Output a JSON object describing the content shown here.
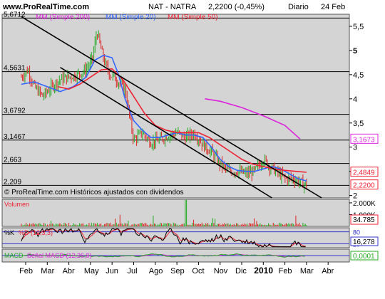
{
  "header": {
    "site": "www.ProRealTime.com",
    "instrument": "NAT - NATRA",
    "last": "2,2200 (-0,45%)",
    "period": "Diario",
    "date": "24 Feb"
  },
  "legend": {
    "ma200": "MM (Simple 200)",
    "ma20": "MM (Simple 20)",
    "ma50": "MM (Simple 50)"
  },
  "notice": "© ProRealTime.com Históricos ajustados con dividendos",
  "colors": {
    "background": "#d4d4d4",
    "price_up": "#22aa22",
    "price_down": "#dd2222",
    "ma20": "#3366ff",
    "ma50": "#ee2233",
    "ma200": "#dd22dd",
    "trendline": "#000000"
  },
  "price_panel": {
    "y_ticks": [
      "5,5",
      "5",
      "4,5",
      "4",
      "3,5",
      "3",
      "2,5",
      "2"
    ],
    "y_tick_values": [
      5.5,
      5,
      4.5,
      4,
      3.5,
      3,
      2.5,
      2
    ],
    "ylim": [
      1.95,
      5.75
    ],
    "level_labels": [
      "5,6712",
      "4,5631",
      "3,6792",
      "3,1467",
      "2,663",
      "2,209"
    ],
    "level_values": [
      5.6712,
      4.5631,
      3.6792,
      3.1467,
      2.663,
      2.209
    ],
    "badges": [
      {
        "text": "3,1673",
        "value": 3.1673,
        "color": "#dd22dd"
      },
      {
        "text": "2,4849",
        "value": 2.4849,
        "color": "#ee2233"
      },
      {
        "text": "2,2200",
        "value": 2.22,
        "color": "#ee2233"
      }
    ]
  },
  "volume_panel": {
    "label": "Volumen",
    "ticks": [
      "2.000K",
      "1.000K"
    ],
    "tick_values": [
      2000,
      1000
    ],
    "max": 2300,
    "last_badge": "34.785"
  },
  "k_panel": {
    "label": "%K",
    "sub": "%D (12,3,3)",
    "ticks": [
      "80",
      "20"
    ],
    "tick_values": [
      80,
      20
    ],
    "last_badge": "16,278"
  },
  "macd_panel": {
    "label": "MACD",
    "sub": "Señal MACD (12,26,9)",
    "last_badge": "0,0001"
  },
  "x_axis": {
    "labels": [
      "Feb",
      "Mar",
      "Abr",
      "May",
      "Jun",
      "Jul",
      "Ago",
      "Sep",
      "Oct",
      "Nov",
      "Dic",
      "2010",
      "Feb",
      "Mar",
      "Abr"
    ],
    "month_index": [
      0,
      1,
      2,
      3,
      4,
      5,
      6,
      7,
      8,
      9,
      10,
      11,
      12,
      13,
      14
    ],
    "bold_label": "2010"
  },
  "chart_data": {
    "type": "line",
    "title": "NAT - NATRA 2,2200 (-0,45%) Diario 24 Feb",
    "x_unit": "month index (0 = Feb 2009)",
    "ylim": [
      1.95,
      5.75
    ],
    "series": [
      {
        "name": "NAT - NATRA",
        "x": [
          -0.2,
          0.1,
          0.4,
          0.8,
          1.2,
          1.6,
          2.0,
          2.4,
          2.8,
          3.1,
          3.3,
          3.5,
          3.7,
          3.9,
          4.2,
          4.6,
          5.0,
          5.4,
          5.8,
          6.2,
          6.6,
          7.0,
          7.4,
          7.8,
          8.2,
          8.6,
          9.0,
          9.4,
          9.8,
          10.2,
          10.6,
          11.0,
          11.3,
          11.6,
          12.0,
          12.4,
          12.8,
          13.0
        ],
        "y": [
          4.45,
          4.6,
          4.25,
          4.05,
          4.25,
          4.4,
          4.45,
          4.5,
          4.6,
          4.85,
          5.4,
          5.0,
          4.7,
          4.5,
          4.4,
          4.2,
          3.15,
          3.3,
          3.1,
          3.15,
          3.25,
          3.3,
          3.2,
          3.3,
          3.05,
          2.9,
          2.65,
          2.5,
          2.5,
          2.45,
          2.5,
          2.75,
          2.6,
          2.5,
          2.35,
          2.35,
          2.25,
          2.22
        ]
      },
      {
        "name": "MM (Simple 20)",
        "x": [
          -0.2,
          0.4,
          1.0,
          1.6,
          2.2,
          2.8,
          3.2,
          3.6,
          4.0,
          4.3,
          4.6,
          5.0,
          5.4,
          5.8,
          6.2,
          6.6,
          7.0,
          7.4,
          7.8,
          8.2,
          8.6,
          9.0,
          9.4,
          9.8,
          10.2,
          10.6,
          11.0,
          11.4,
          11.8,
          12.2,
          12.6,
          13.0
        ],
        "y": [
          4.3,
          4.35,
          4.25,
          4.15,
          4.25,
          4.45,
          4.8,
          4.9,
          4.85,
          4.5,
          4.0,
          3.55,
          3.35,
          3.2,
          3.2,
          3.25,
          3.3,
          3.25,
          3.25,
          3.2,
          3.0,
          2.75,
          2.6,
          2.52,
          2.5,
          2.5,
          2.55,
          2.6,
          2.55,
          2.45,
          2.35,
          2.3
        ]
      },
      {
        "name": "MM (Simple 50)",
        "x": [
          1.5,
          2.0,
          2.5,
          3.0,
          3.5,
          4.0,
          4.5,
          5.0,
          5.5,
          6.0,
          6.5,
          7.0,
          7.5,
          8.0,
          8.5,
          9.0,
          9.5,
          10.0,
          10.5,
          11.0,
          11.5,
          12.0,
          12.5,
          13.0
        ],
        "y": [
          4.25,
          4.2,
          4.3,
          4.45,
          4.6,
          4.62,
          4.4,
          4.05,
          3.7,
          3.45,
          3.35,
          3.3,
          3.3,
          3.3,
          3.2,
          3.05,
          2.9,
          2.75,
          2.65,
          2.6,
          2.55,
          2.52,
          2.5,
          2.48
        ]
      },
      {
        "name": "MM (Simple 200)",
        "x": [
          8.3,
          9.0,
          10.0,
          11.0,
          12.0,
          12.7
        ],
        "y": [
          4.0,
          3.95,
          3.82,
          3.65,
          3.45,
          3.17
        ]
      }
    ],
    "trendlines": [
      {
        "x": [
          -0.2,
          13.7
        ],
        "y": [
          5.7,
          1.95
        ]
      },
      {
        "x": [
          1.6,
          11.4
        ],
        "y": [
          4.65,
          1.95
        ]
      }
    ]
  }
}
